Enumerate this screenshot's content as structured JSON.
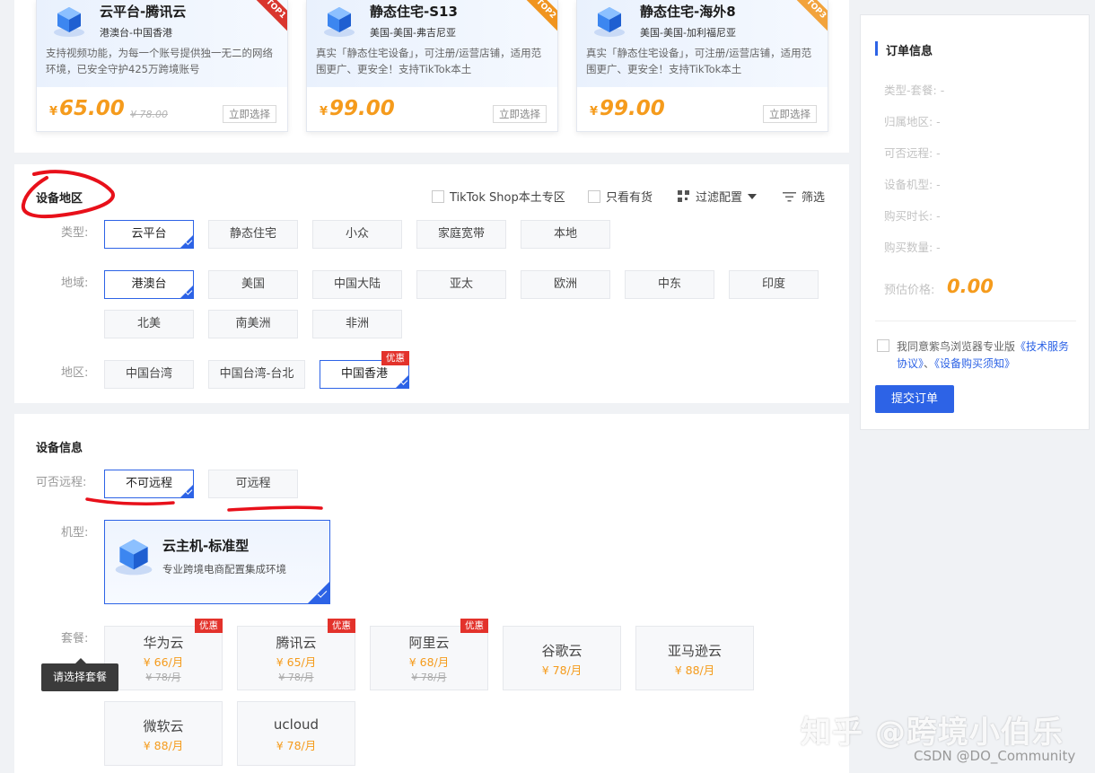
{
  "products": [
    {
      "title": "云平台-腾讯云",
      "region": "港澳台-中国香港",
      "desc": "支持视频功能，为每一个账号提供独一无二的网络环境，已安全守护425万跨境账号",
      "currency": "¥",
      "price": "65.00",
      "old_price": "¥ 78.00",
      "pick_label": "立即选择",
      "rank": "TOP1",
      "rank_color": "#d9362e"
    },
    {
      "title": "静态住宅-S13",
      "region": "美国-美国-弗吉尼亚",
      "desc": "真实「静态住宅设备」，可注册/运营店铺，适用范围更广、更安全！支持TikTok本土",
      "currency": "¥",
      "price": "99.00",
      "old_price": "",
      "pick_label": "立即选择",
      "rank": "TOP2",
      "rank_color": "#f0941f"
    },
    {
      "title": "静态住宅-海外8",
      "region": "美国-美国-加利福尼亚",
      "desc": "真实「静态住宅设备」，可注册/运营店铺，适用范围更广、更安全！支持TikTok本土",
      "currency": "¥",
      "price": "99.00",
      "old_price": "",
      "pick_label": "立即选择",
      "rank": "TOP3",
      "rank_color": "#f2a33c"
    }
  ],
  "region_section": {
    "title": "设备地区",
    "filters": {
      "tiktok": "TikTok Shop本土专区",
      "in_stock": "只看有货",
      "config": "过滤配置",
      "screen": "筛选"
    },
    "type_label": "类型:",
    "types": [
      "云平台",
      "静态住宅",
      "小众",
      "家庭宽带",
      "本地"
    ],
    "area_label": "地域:",
    "areas": [
      "港澳台",
      "美国",
      "中国大陆",
      "亚太",
      "欧洲",
      "中东",
      "印度",
      "北美",
      "南美洲",
      "非洲"
    ],
    "district_label": "地区:",
    "districts": [
      "中国台湾",
      "中国台湾-台北",
      "中国香港"
    ],
    "discount_badge": "优惠"
  },
  "device_section": {
    "title": "设备信息",
    "remote_label": "可否远程:",
    "remote_options": [
      "不可远程",
      "可远程"
    ],
    "model_label": "机型:",
    "model": {
      "title": "云主机-标准型",
      "sub": "专业跨境电商配置集成环境"
    },
    "plan_label": "套餐:",
    "tooltip": "请选择套餐",
    "plans": [
      {
        "name": "华为云",
        "price": "¥ 66/月",
        "old": "¥ 78/月",
        "badge": "优惠"
      },
      {
        "name": "腾讯云",
        "price": "¥ 65/月",
        "old": "¥ 78/月",
        "badge": "优惠"
      },
      {
        "name": "阿里云",
        "price": "¥ 68/月",
        "old": "¥ 78/月",
        "badge": "优惠"
      },
      {
        "name": "谷歌云",
        "price": "¥ 78/月",
        "old": "",
        "badge": ""
      },
      {
        "name": "亚马逊云",
        "price": "¥ 88/月",
        "old": "",
        "badge": ""
      },
      {
        "name": "微软云",
        "price": "¥ 88/月",
        "old": "",
        "badge": ""
      },
      {
        "name": "ucloud",
        "price": "¥ 78/月",
        "old": "",
        "badge": ""
      }
    ]
  },
  "order": {
    "title": "订单信息",
    "fields": [
      "类型-套餐: -",
      "归属地区: -",
      "可否远程: -",
      "设备机型: -",
      "购买时长: -",
      "购买数量: -"
    ],
    "est_label": "预估价格:",
    "est_value": "0.00",
    "agree_prefix": "我同意紫鸟浏览器专业版",
    "agree_link1": "《技术服务协议》",
    "agree_sep": "、",
    "agree_link2": "《设备购买须知》",
    "submit": "提交订单"
  },
  "watermark": "知乎 @跨境小伯乐",
  "credit": "CSDN @DO_Community",
  "colors": {
    "accent": "#2d63e6",
    "price": "#f59b1c",
    "badge": "#e3322b",
    "annotation": "#e8101a"
  }
}
